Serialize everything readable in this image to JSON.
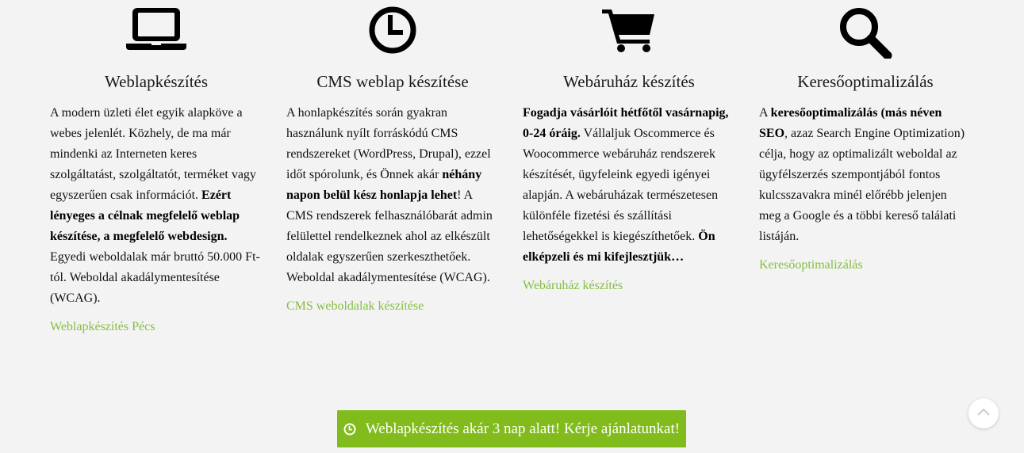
{
  "services": [
    {
      "icon": "laptop-icon",
      "title": "Weblapkészítés",
      "text": [
        {
          "t": "A modern üzleti élet egyik alapköve a webes jelenlét. Közhely, de ma már mindenki az Interneten keres szolgáltatást, szolgáltatót, terméket vagy egyszerűen csak információt. ",
          "b": false
        },
        {
          "t": "Ezért lényeges a célnak megfelelő weblap készítése, a megfelelő webdesign.",
          "b": true
        },
        {
          "t": " Egyedi weboldalak már bruttó 50.000 Ft-tól. Weboldal akadálymentesítése (WCAG).",
          "b": false
        }
      ],
      "link": "Weblapkészítés Pécs"
    },
    {
      "icon": "clock-icon",
      "title": "CMS weblap készítése",
      "text": [
        {
          "t": "A honlapkészítés során gyakran használunk nyílt forráskódú CMS rendszereket (WordPress, Drupal), ezzel időt spórolunk, és Önnek akár ",
          "b": false
        },
        {
          "t": "néhány napon belül kész honlapja lehet",
          "b": true
        },
        {
          "t": "! A CMS rendszerek felhasználóbarát admin felülettel rendelkeznek ahol az elkészült oldalak egyszerűen szerkeszthetőek. Weboldal akadálymentesítése (WCAG).",
          "b": false
        }
      ],
      "link": "CMS weboldalak készítése"
    },
    {
      "icon": "shopping-cart-icon",
      "title": "Webáruház készítés",
      "text": [
        {
          "t": "Fogadja vásárlóit hétfőtől vasárnapig, 0-24 óráig.",
          "b": true
        },
        {
          "t": " Vállaljuk Oscommerce és Woocommerce webáruház rendszerek készítését, ügyfeleink egyedi igényei alapján. A webáruházak természetesen különféle fizetési és szállítási lehetőségekkel is kiegészíthetőek. ",
          "b": false
        },
        {
          "t": "Ön elképzeli és mi kifejlesztjük…",
          "b": true
        }
      ],
      "link": "Webáruház készítés"
    },
    {
      "icon": "search-icon",
      "title": "Keresőoptimalizálás",
      "text": [
        {
          "t": "A ",
          "b": false
        },
        {
          "t": "keresőoptimalizálás (más néven SEO",
          "b": true
        },
        {
          "t": ", azaz Search Engine Optimization) célja, hogy az optimalizált weboldal az ügyfélszerzés szempontjából fontos kulcsszavakra minél előrébb jelenjen meg a Google és a többi kereső találati listáján.",
          "b": false
        }
      ],
      "link": "Keresőoptimalizálás"
    }
  ],
  "cta": {
    "icon": "clock-icon",
    "label": "Weblapkészítés akár 3 nap alatt! Kérje ajánlatunkat!"
  },
  "scroll_top": {
    "icon": "chevron-up-icon"
  },
  "colors": {
    "link": "#83bf41",
    "cta_bg": "#82bc1c",
    "background": "#f3f3f3"
  }
}
